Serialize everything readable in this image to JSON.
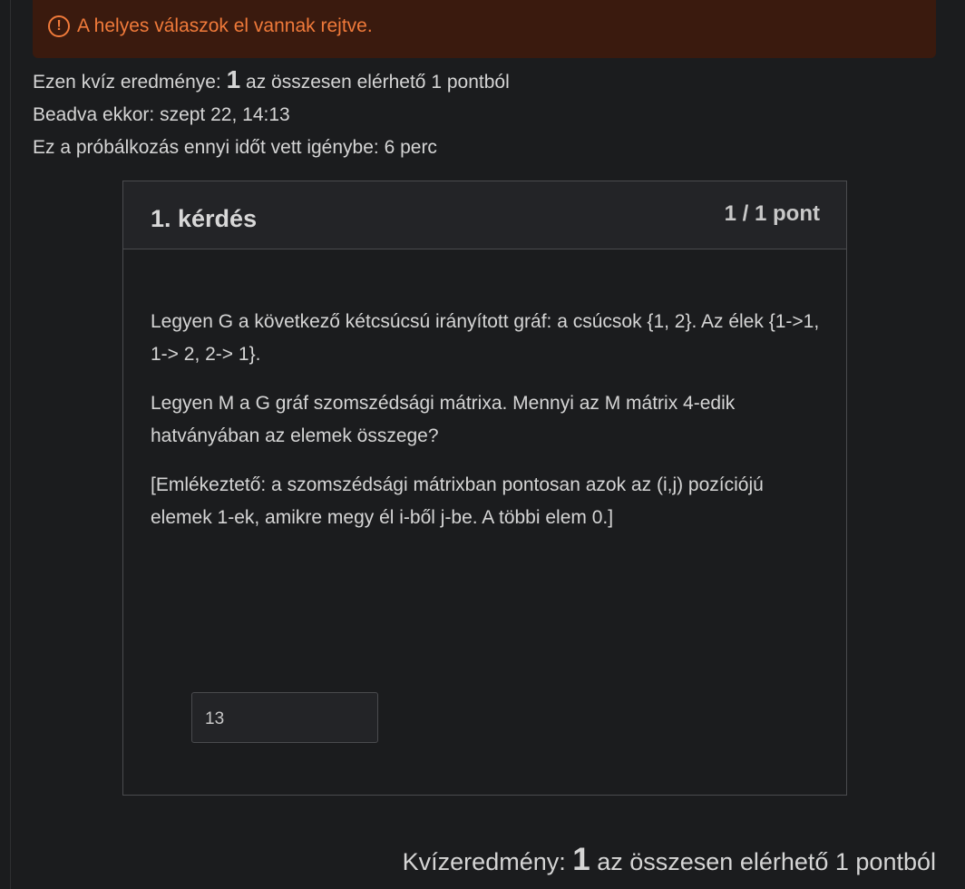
{
  "alert": {
    "icon": "exclamation-circle-icon",
    "text": "A helyes válaszok el vannak rejtve.",
    "color": "#f07a3a"
  },
  "result": {
    "prefix": "Ezen kvíz eredménye:",
    "score": "1",
    "suffix": "az összesen elérhető 1 pontból"
  },
  "submitted": "Beadva ekkor: szept 22, 14:13",
  "duration": "Ez a próbálkozás ennyi időt vett igénybe: 6 perc",
  "question": {
    "title": "1. kérdés",
    "points": "1 / 1 pont",
    "paragraphs": [
      "Legyen G a következő kétcsúcsú irányított gráf: a csúcsok {1, 2}. Az élek {1->1, 1-> 2, 2-> 1}.",
      "Legyen M a G gráf szomszédsági mátrixa. Mennyi az M mátrix 4-edik hatványában az elemek összege?",
      "[Emlékeztető: a szomszédsági mátrixban pontosan azok az (i,j) pozíciójú elemek 1-ek, amikre megy él i-ből j-be. A többi elem 0.]"
    ],
    "answer": "13"
  },
  "footer": {
    "prefix": "Kvízeredmény:",
    "score": "1",
    "suffix": "az összesen elérhető 1 pontból"
  }
}
